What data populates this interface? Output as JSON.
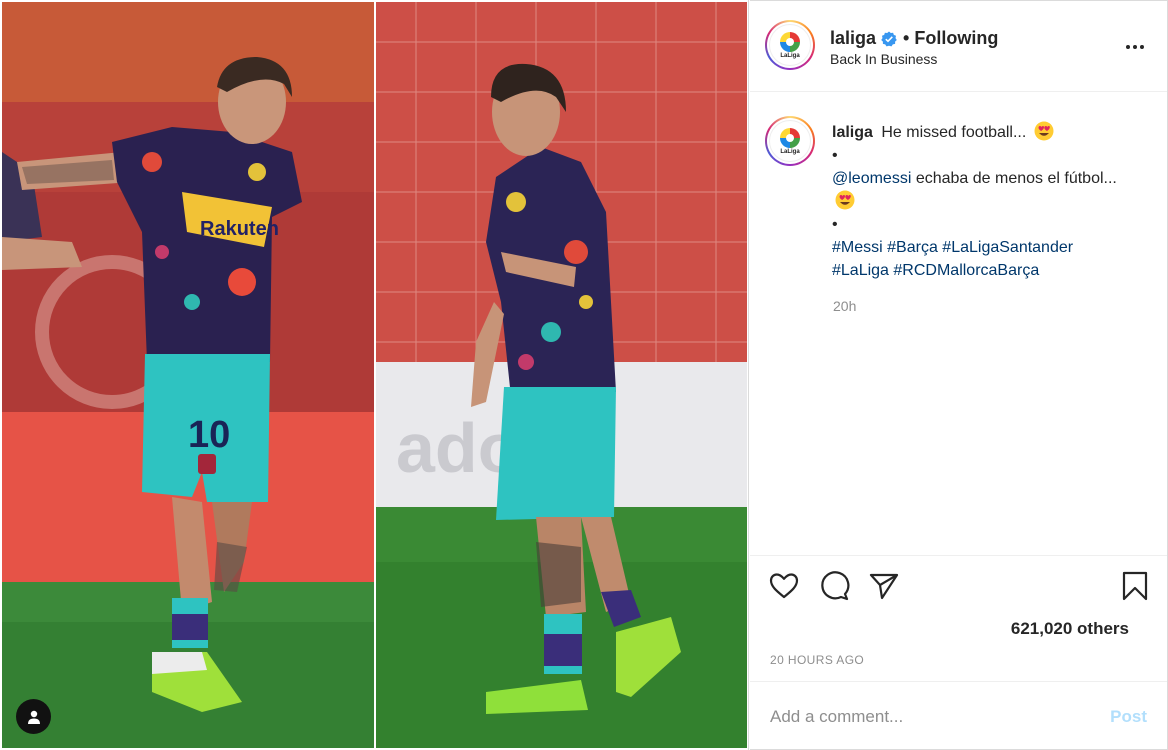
{
  "post": {
    "username": "laliga",
    "verified": true,
    "follow_status": "Following",
    "separator": "•",
    "location": "Back In Business",
    "avatar_text": "LaLiga"
  },
  "caption": {
    "username": "laliga",
    "line1": "He missed football...",
    "bullet": "•",
    "mention": "@leomessi",
    "spanish": "echaba de menos el fútbol...",
    "hashtags": [
      "#Messi",
      "#Barça",
      "#LaLigaSantander",
      "#LaLiga",
      "#RCDMallorcaBarça"
    ],
    "time_short": "20h"
  },
  "engagement": {
    "likes_text": "621,020 others",
    "time_long": "20 HOURS AGO"
  },
  "comment": {
    "placeholder": "Add a comment...",
    "post_label": "Post"
  },
  "icons": {
    "like": "heart-outline-icon",
    "comment": "speech-bubble-icon",
    "share": "paper-plane-icon",
    "save": "bookmark-icon",
    "more": "ellipsis-icon",
    "tag": "person-icon",
    "verified": "verified-badge-icon"
  },
  "colors": {
    "link_blue": "#00376b",
    "verified_blue": "#3897f0",
    "post_disabled": "#b2dffc",
    "muted": "#8e8e8e"
  }
}
